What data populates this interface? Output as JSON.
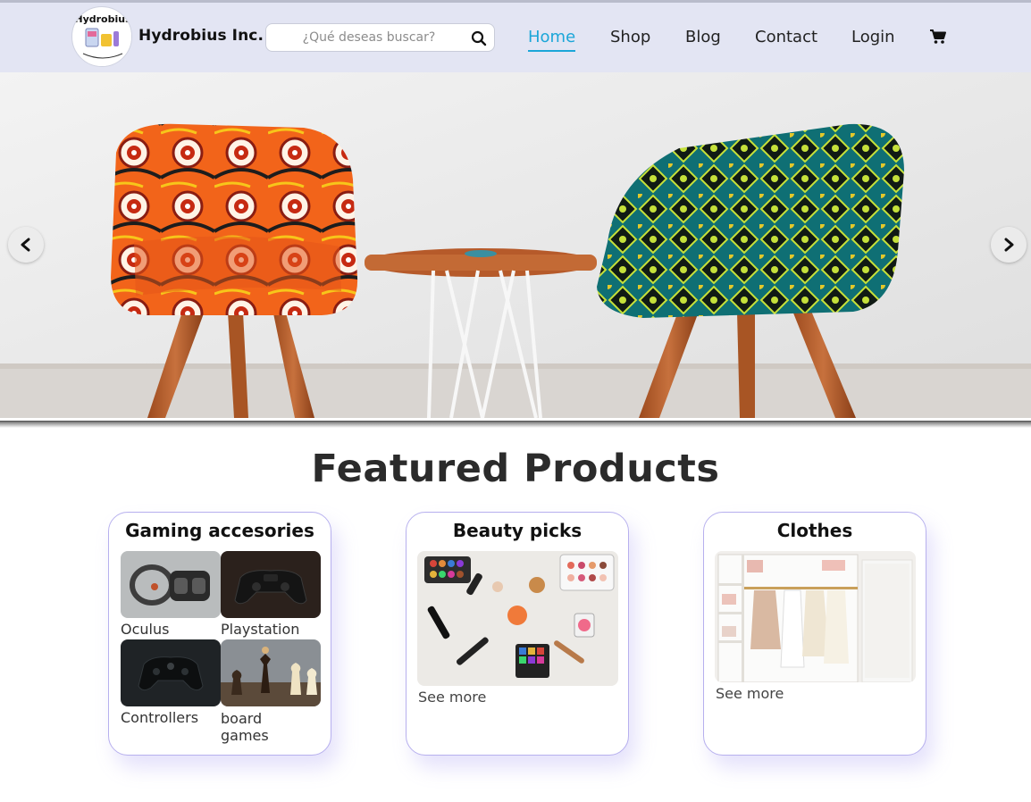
{
  "header": {
    "logo_text": "Hydrobius",
    "brand": "Hydrobius Inc.",
    "search_placeholder": "¿Qué deseas buscar?",
    "nav": [
      {
        "label": "Home",
        "active": true
      },
      {
        "label": "Shop",
        "active": false
      },
      {
        "label": "Blog",
        "active": false
      },
      {
        "label": "Contact",
        "active": false
      },
      {
        "label": "Login",
        "active": false
      }
    ],
    "cart_icon": "cart-icon"
  },
  "carousel": {
    "prev_icon": "chevron-left-icon",
    "next_icon": "chevron-right-icon"
  },
  "featured": {
    "title": "Featured Products",
    "cards": [
      {
        "title": "Gaming accesories",
        "items": [
          {
            "label": "Oculus"
          },
          {
            "label": "Playstation"
          },
          {
            "label": "Controllers"
          },
          {
            "label": "board games"
          }
        ]
      },
      {
        "title": "Beauty picks",
        "link": "See more"
      },
      {
        "title": "Clothes",
        "link": "See more"
      }
    ]
  },
  "colors": {
    "header_bg": "#e3e5f3",
    "accent": "#1ba6d8",
    "card_border": "#b7b0ee"
  }
}
